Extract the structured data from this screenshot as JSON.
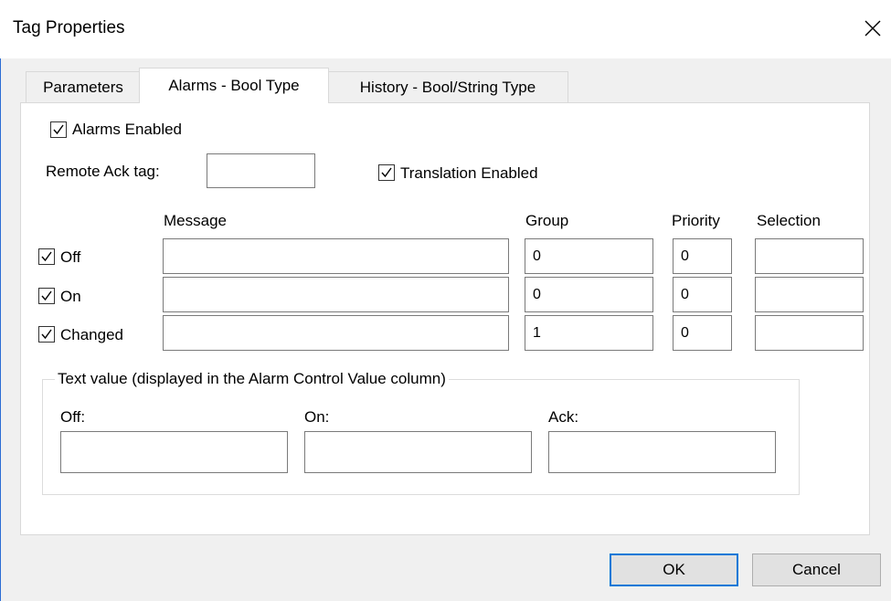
{
  "window": {
    "title": "Tag Properties"
  },
  "tabs": [
    {
      "label": "Parameters"
    },
    {
      "label": "Alarms - Bool Type"
    },
    {
      "label": "History - Bool/String Type"
    }
  ],
  "alarms": {
    "enabled_label": "Alarms Enabled",
    "remote_ack_label": "Remote Ack tag:",
    "remote_ack_value": "",
    "translation_label": "Translation Enabled",
    "columns": {
      "message": "Message",
      "group": "Group",
      "priority": "Priority",
      "selection": "Selection"
    },
    "rows": [
      {
        "label": "Off",
        "message": "",
        "group": "0",
        "priority": "0",
        "selection": ""
      },
      {
        "label": "On",
        "message": "",
        "group": "0",
        "priority": "0",
        "selection": ""
      },
      {
        "label": "Changed",
        "message": "",
        "group": "1",
        "priority": "0",
        "selection": ""
      }
    ]
  },
  "text_value": {
    "legend": "Text value (displayed in the Alarm Control Value column)",
    "off_label": "Off:",
    "on_label": "On:",
    "ack_label": "Ack:",
    "off_value": "",
    "on_value": "",
    "ack_value": ""
  },
  "buttons": {
    "ok": "OK",
    "cancel": "Cancel"
  }
}
